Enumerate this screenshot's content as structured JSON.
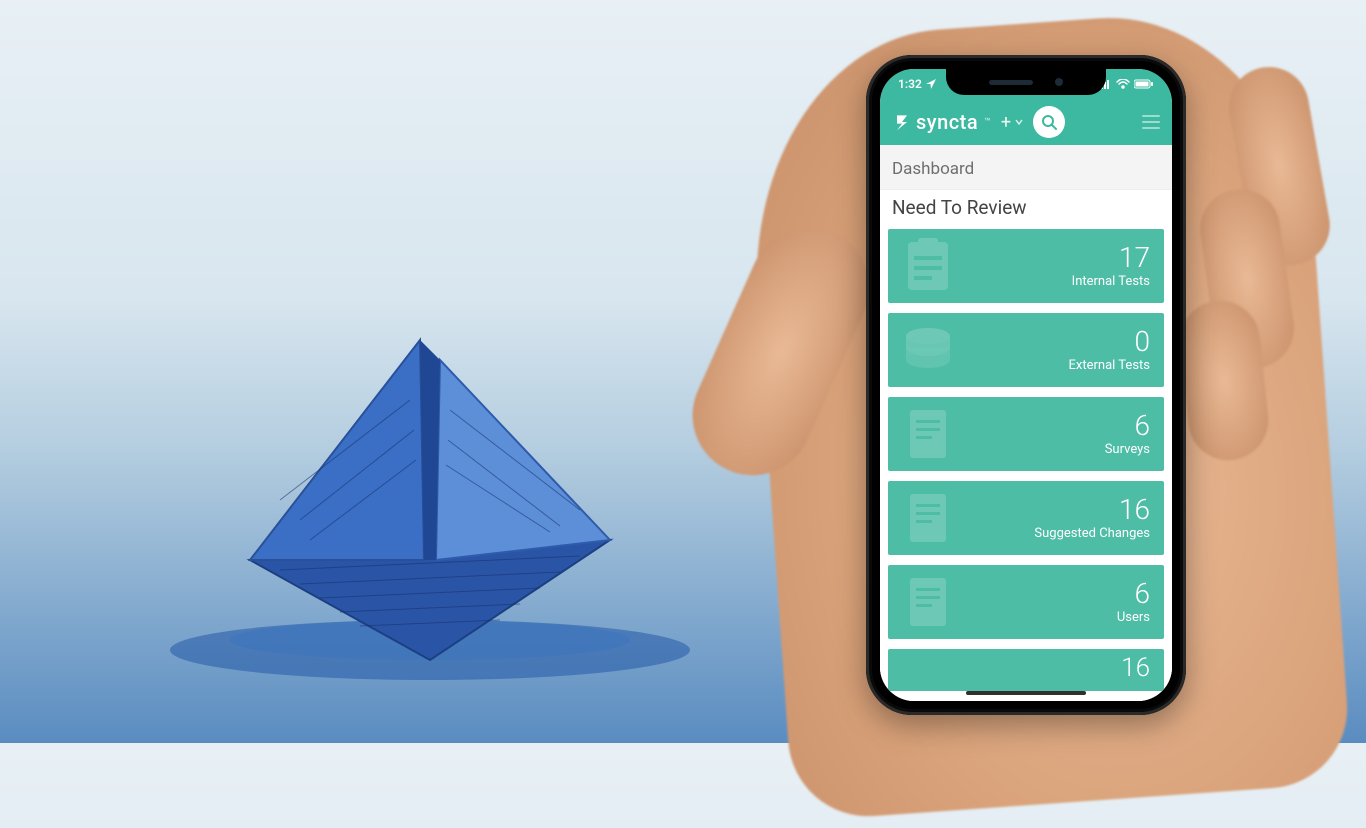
{
  "colors": {
    "teal": "#3cb9a0",
    "card": "#4dbda6"
  },
  "status": {
    "time": "1:32",
    "location_icon": "location-arrow",
    "signal": "•••",
    "wifi": "wifi",
    "battery": "battery"
  },
  "header": {
    "brand": "syncta",
    "plus_label": "+",
    "search_title": "Search",
    "menu_title": "Menu"
  },
  "page": {
    "title": "Dashboard",
    "section": "Need To Review"
  },
  "cards": [
    {
      "value": "17",
      "label": "Internal Tests",
      "icon": "clipboard"
    },
    {
      "value": "0",
      "label": "External Tests",
      "icon": "stack"
    },
    {
      "value": "6",
      "label": "Surveys",
      "icon": "form"
    },
    {
      "value": "16",
      "label": "Suggested Changes",
      "icon": "form"
    },
    {
      "value": "6",
      "label": "Users",
      "icon": "form"
    },
    {
      "value": "16",
      "label": "",
      "icon": "form"
    }
  ]
}
